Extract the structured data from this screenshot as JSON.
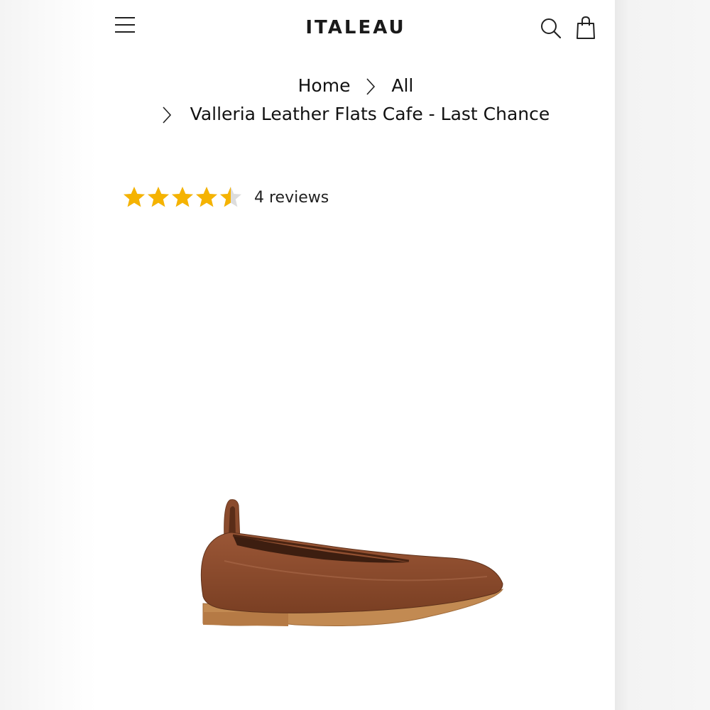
{
  "header": {
    "logo": "ITALEAU"
  },
  "breadcrumb": {
    "home": "Home",
    "all": "All",
    "current": "Valleria Leather Flats Cafe - Last Chance"
  },
  "rating": {
    "value": 4.5,
    "max": 5,
    "star_color": "#f5b301",
    "empty_color": "#dddddd",
    "reviews_label": "4 reviews"
  },
  "product": {
    "image_icon": "ballet-flat-shoe",
    "leather_color": "#8a4b2d",
    "sole_color": "#c28a52"
  },
  "icons": {
    "menu": "hamburger-menu-icon",
    "search": "search-icon",
    "cart": "shopping-bag-icon",
    "separator": "chevron-right-icon"
  }
}
